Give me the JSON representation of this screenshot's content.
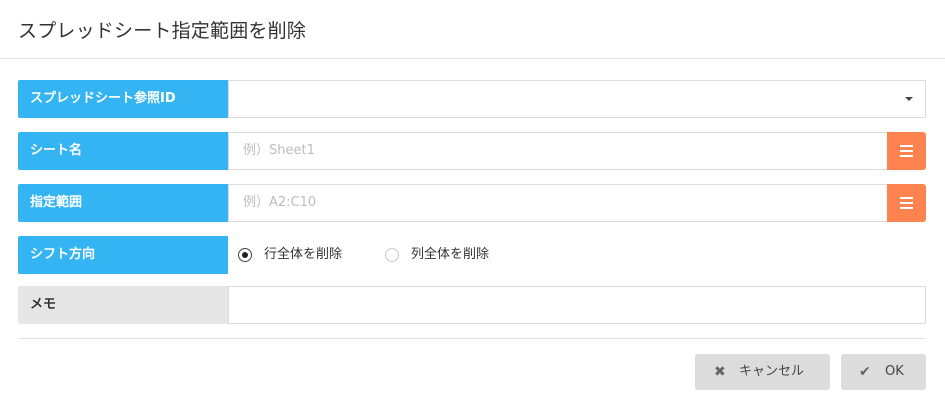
{
  "dialog": {
    "title": "スプレッドシート指定範囲を削除"
  },
  "fields": {
    "spreadsheet_id": {
      "label": "スプレッドシート参照ID",
      "value": ""
    },
    "sheet_name": {
      "label": "シート名",
      "placeholder": "例）Sheet1"
    },
    "range": {
      "label": "指定範囲",
      "placeholder": "例）A2:C10"
    },
    "shift": {
      "label": "シフト方向",
      "options": [
        {
          "label": "行全体を削除",
          "checked": true
        },
        {
          "label": "列全体を削除",
          "checked": false
        }
      ]
    },
    "memo": {
      "label": "メモ",
      "value": ""
    }
  },
  "buttons": {
    "cancel": "キャンセル",
    "ok": "OK"
  },
  "icons": {
    "cancel": "close-icon",
    "ok": "check-icon",
    "list": "list-icon",
    "dropdown": "caret-down-icon"
  },
  "colors": {
    "label_bg": "#35b4f4",
    "list_button": "#fd8451",
    "button_bg": "#dcdcdc"
  }
}
